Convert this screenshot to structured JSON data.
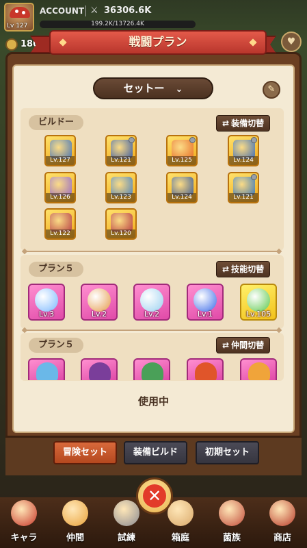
{
  "player": {
    "account_label": "ACCOUNT",
    "level_label": "Lv 127",
    "power": "36306.6K",
    "exp_text": "199.2K/13726.4K",
    "coins": "180"
  },
  "header": {
    "title": "戦闘プラン"
  },
  "set_selector": {
    "value": "セットー"
  },
  "build_section": {
    "label": "ビルドー",
    "switch_label": "装備切替",
    "items": [
      {
        "level": "Lv.127",
        "icon": "gauntlet-icon"
      },
      {
        "level": "Lv.121",
        "icon": "belt-icon"
      },
      {
        "level": "Lv.125",
        "icon": "fire-ring-icon"
      },
      {
        "level": "Lv.124",
        "icon": "helmet-icon"
      },
      {
        "level": "Lv.126",
        "icon": "robe-icon"
      },
      {
        "level": "Lv.123",
        "icon": "armor-icon"
      },
      {
        "level": "Lv.124",
        "icon": "spiked-helm-icon"
      },
      {
        "level": "Lv.121",
        "icon": "cape-icon"
      },
      {
        "level": "Lv.122",
        "icon": "chest-armor-icon"
      },
      {
        "level": "Lv.120",
        "icon": "boots-icon"
      }
    ]
  },
  "skill_section": {
    "label": "プラン５",
    "switch_label": "技能切替",
    "items": [
      {
        "level": "Lv.3",
        "icon": "lightning-skill-icon"
      },
      {
        "level": "Lv.2",
        "icon": "mushroom-skill-icon"
      },
      {
        "level": "Lv.2",
        "icon": "sword-skill-icon"
      },
      {
        "level": "Lv.1",
        "icon": "water-orb-skill-icon"
      },
      {
        "level": "Lv.105",
        "icon": "green-slime-skill-icon"
      }
    ]
  },
  "companion_section": {
    "label": "プラン５",
    "switch_label": "仲間切替",
    "items": [
      {
        "icon": "cat-companion-icon"
      },
      {
        "icon": "pirate-companion-icon"
      },
      {
        "icon": "frog-companion-icon"
      },
      {
        "icon": "dragon-companion-icon"
      },
      {
        "icon": "gecko-companion-icon"
      }
    ]
  },
  "status_text": "使用中",
  "tabs": [
    {
      "label": "冒険セット",
      "active": true
    },
    {
      "label": "装備ビルド",
      "active": false
    },
    {
      "label": "初期セット",
      "active": false
    }
  ],
  "nav": [
    {
      "label": "キャラ",
      "icon": "mushroom-character-icon"
    },
    {
      "label": "仲間",
      "icon": "paw-icon"
    },
    {
      "label": "試練",
      "icon": "crossed-swords-icon"
    },
    {
      "label": "箱庭",
      "icon": "garden-icon"
    },
    {
      "label": "菌族",
      "icon": "clan-icon"
    },
    {
      "label": "商店",
      "icon": "shop-icon"
    }
  ],
  "colors": {
    "banner": "#c8402f",
    "equip_bg": "#f5b928",
    "skill_bg": "#ef6ac0",
    "active_tab": "#c9572a"
  }
}
